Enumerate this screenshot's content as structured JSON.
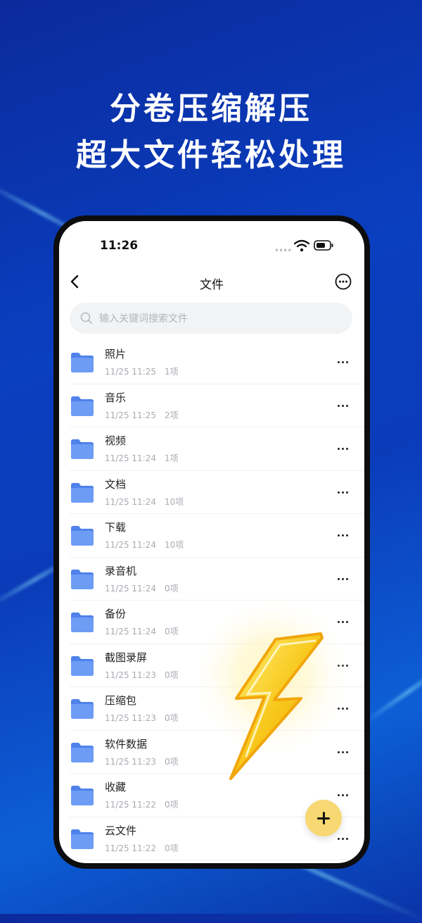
{
  "promo": {
    "headline_line1": "分卷压缩解压",
    "headline_line2": "超大文件轻松处理"
  },
  "status_bar": {
    "time": "11:26"
  },
  "nav": {
    "title": "文件"
  },
  "search": {
    "placeholder": "输入关键词搜索文件",
    "value": ""
  },
  "folders": [
    {
      "name": "照片",
      "date": "11/25 11:25",
      "count": "1项"
    },
    {
      "name": "音乐",
      "date": "11/25 11:25",
      "count": "2项"
    },
    {
      "name": "视频",
      "date": "11/25 11:24",
      "count": "1项"
    },
    {
      "name": "文档",
      "date": "11/25 11:24",
      "count": "10项"
    },
    {
      "name": "下载",
      "date": "11/25 11:24",
      "count": "10项"
    },
    {
      "name": "录音机",
      "date": "11/25 11:24",
      "count": "0项"
    },
    {
      "name": "备份",
      "date": "11/25 11:24",
      "count": "0项"
    },
    {
      "name": "截图录屏",
      "date": "11/25 11:23",
      "count": "0项"
    },
    {
      "name": "压缩包",
      "date": "11/25 11:23",
      "count": "0项"
    },
    {
      "name": "软件数据",
      "date": "11/25 11:23",
      "count": "0项"
    },
    {
      "name": "收藏",
      "date": "11/25 11:22",
      "count": "0项"
    },
    {
      "name": "云文件",
      "date": "11/25 11:22",
      "count": "0项"
    }
  ],
  "colors": {
    "background": "#0b3bb8",
    "folder": "#5b8ef0",
    "fab": "#f7d873",
    "bolt": "#f5c21b"
  },
  "icons": [
    "back-icon",
    "more-circle-icon",
    "search-icon",
    "folder-icon",
    "more-icon",
    "plus-icon",
    "wifi-icon",
    "battery-icon",
    "lightning-icon"
  ]
}
